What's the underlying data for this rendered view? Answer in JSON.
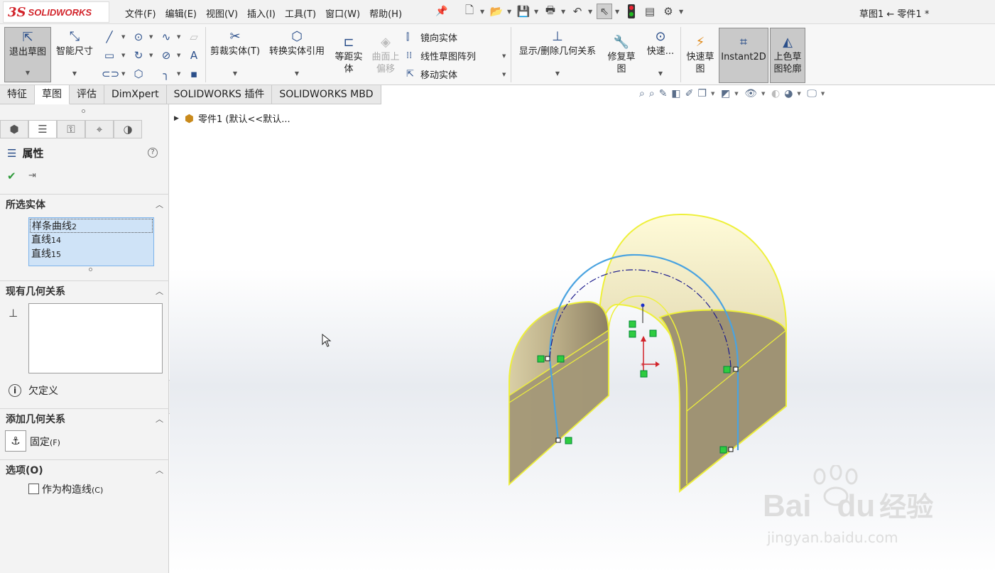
{
  "app": {
    "logo_prefix": "3S",
    "logo_text": "SOLIDWORKS",
    "doc_title": "草图1 ← 零件1 *"
  },
  "menu": [
    "文件(F)",
    "编辑(E)",
    "视图(V)",
    "插入(I)",
    "工具(T)",
    "窗口(W)",
    "帮助(H)"
  ],
  "ribbon": {
    "exit_sketch": "退出草图",
    "smart_dim": "智能尺寸",
    "trim": "剪裁实体(T)",
    "convert": "转换实体引用",
    "offset": [
      "等距实",
      "体"
    ],
    "surface_offset": [
      "曲面上",
      "偏移"
    ],
    "mirror": "镜向实体",
    "linear_pattern": "线性草图阵列",
    "move": "移动实体",
    "show_relations": "显示/删除几何关系",
    "repair": [
      "修复草",
      "图"
    ],
    "quick": "快速...",
    "rapid_sketch": [
      "快速草",
      "图"
    ],
    "instant2d": "Instant2D",
    "shaded_contour": [
      "上色草",
      "图轮廓"
    ]
  },
  "tabs": [
    "特征",
    "草图",
    "评估",
    "DimXpert",
    "SOLIDWORKS 插件",
    "SOLIDWORKS MBD"
  ],
  "active_tab": "草图",
  "tree": {
    "node": "零件1  (默认<<默认..."
  },
  "panel": {
    "title": "属性",
    "sections": {
      "selected": "所选实体",
      "existing": "现有几何关系",
      "add": "添加几何关系",
      "options": "选项(O)"
    },
    "selected_items": [
      {
        "name": "样条曲线",
        "num": "2"
      },
      {
        "name": "直线",
        "num": "14"
      },
      {
        "name": "直线",
        "num": "15"
      }
    ],
    "status": "欠定义",
    "fix": {
      "label": "固定",
      "key": "(F)"
    },
    "construction": {
      "label": "作为构造线",
      "key": "(C)"
    }
  },
  "watermark": {
    "brand": "Bai",
    "brand2": "du",
    "product": "经验",
    "url": "jingyan.baidu.com"
  },
  "colors": {
    "surface": "#b6ab8c",
    "surface_edge": "#eef03a",
    "sketch_curve": "#4aa3e0",
    "construction": "#1a1a8c",
    "relation_marker": "#2ecc40",
    "brand_red": "#d2232a"
  }
}
